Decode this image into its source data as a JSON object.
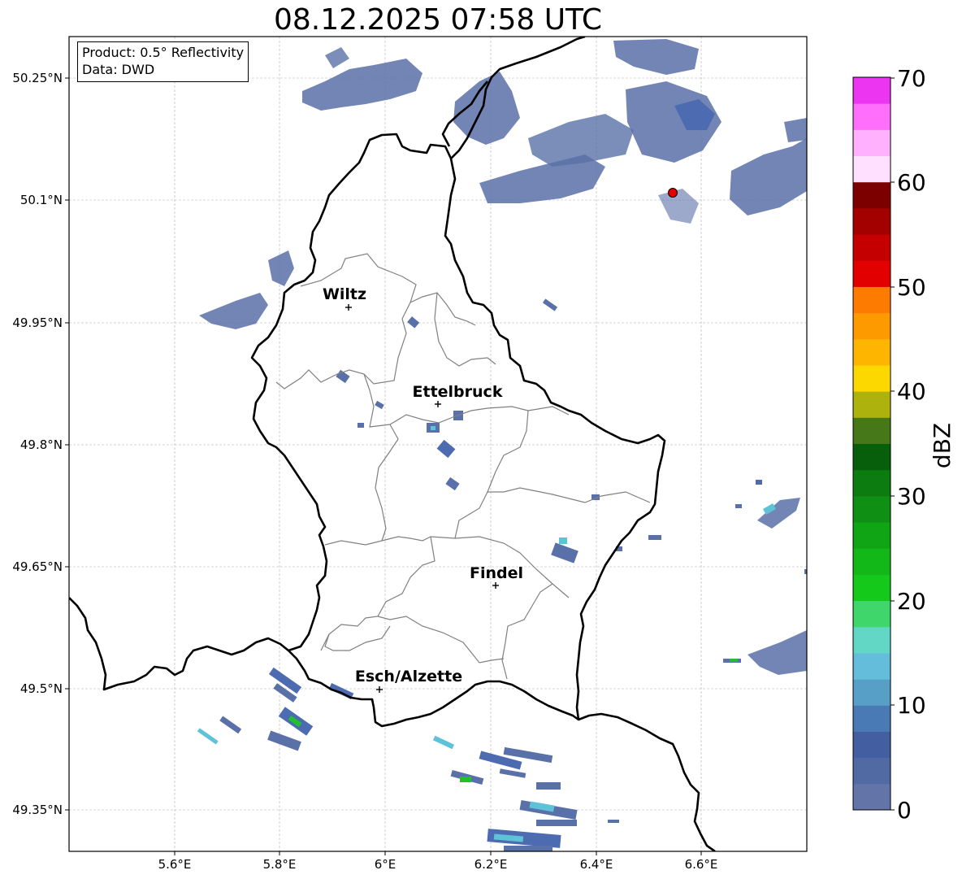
{
  "title": "08.12.2025 07:58 UTC",
  "infobox": {
    "line1": "Product: 0.5° Reflectivity",
    "line2": "Data: DWD"
  },
  "lat_ticks": [
    "50.25°N",
    "50.1°N",
    "49.95°N",
    "49.8°N",
    "49.65°N",
    "49.5°N",
    "49.35°N"
  ],
  "lon_ticks": [
    "5.6°E",
    "5.8°E",
    "6°E",
    "6.2°E",
    "6.4°E",
    "6.6°E"
  ],
  "cities": [
    {
      "name": "Wiltz",
      "lon": 5.93,
      "lat": 49.97
    },
    {
      "name": "Ettelbruck",
      "lon": 6.1,
      "lat": 49.85
    },
    {
      "name": "Findel",
      "lon": 6.21,
      "lat": 49.627
    },
    {
      "name": "Esch/Alzette",
      "lon": 5.99,
      "lat": 49.5
    }
  ],
  "radar_site": {
    "lon": 6.548,
    "lat": 50.11,
    "color": "#e00000"
  },
  "colorbar": {
    "label": "dBZ",
    "ticks": [
      "0",
      "10",
      "20",
      "30",
      "40",
      "50",
      "60",
      "70"
    ],
    "colors": [
      "#6374a8",
      "#526aa3",
      "#445fa1",
      "#4a7ab5",
      "#589fc8",
      "#64bedb",
      "#62d7c5",
      "#3fd66c",
      "#14c91a",
      "#11b818",
      "#10a515",
      "#0f8f13",
      "#0c7b10",
      "#075e0b",
      "#46781a",
      "#aeb20c",
      "#fdd700",
      "#fdb500",
      "#fd9a00",
      "#fd7b00",
      "#e30000",
      "#c50000",
      "#a30000",
      "#7d0000",
      "#ffe0fe",
      "#ffb1fd",
      "#ff6ffb",
      "#ec35f0"
    ]
  },
  "colors": {
    "echo_weak": "#5a70a8",
    "echo_moderate": "#4c6bb0",
    "echo_light": "#5ec2d8",
    "echo_strong": "#1fc22a",
    "border": "#000000",
    "canton": "#808080",
    "grid": "#b0b0b0"
  }
}
